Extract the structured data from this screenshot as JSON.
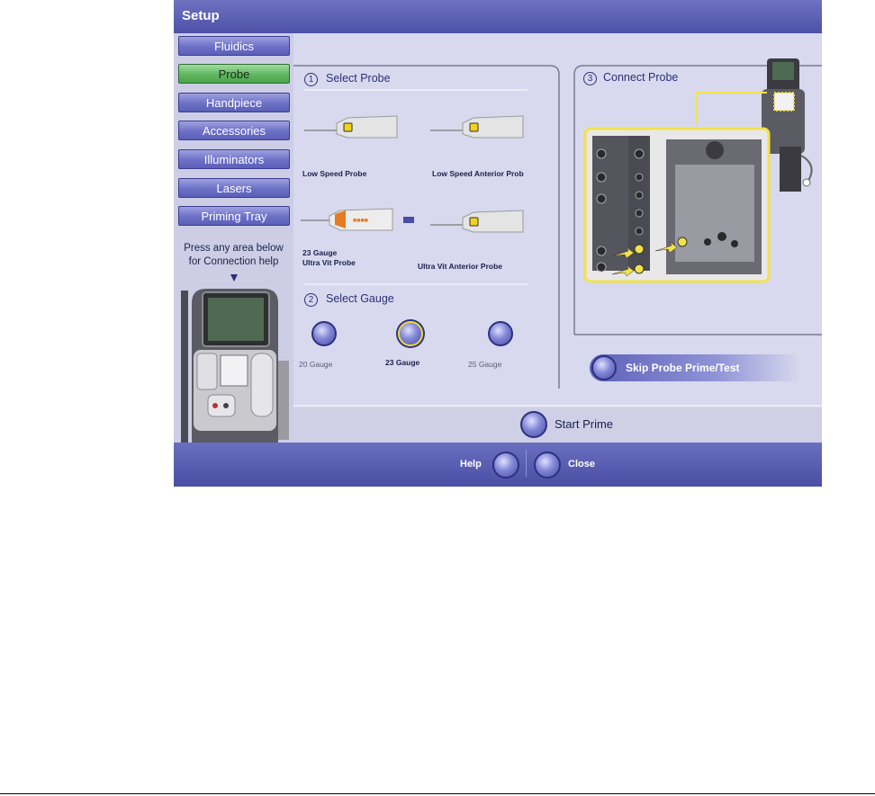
{
  "window": {
    "title": "Setup"
  },
  "nav": {
    "items": [
      {
        "label": "Fluidics"
      },
      {
        "label": "Probe"
      },
      {
        "label": "Handpiece"
      },
      {
        "label": "Accessories"
      },
      {
        "label": "Illuminators"
      },
      {
        "label": "Lasers"
      },
      {
        "label": "Priming Tray"
      }
    ],
    "help_text_line1": "Press any area below",
    "help_text_line2": "for Connection help"
  },
  "select_probe": {
    "number": "1",
    "title": "Select Probe",
    "probes": [
      {
        "label_line1": "Low Speed Probe",
        "label_line2": ""
      },
      {
        "label_line1": "Low  Speed  Anterior Prob",
        "label_line2": ""
      },
      {
        "label_line1": "23 Gauge",
        "label_line2": "Ultra Vit Probe"
      },
      {
        "label_line1": "Ultra Vit Anterior Probe",
        "label_line2": ""
      }
    ]
  },
  "select_gauge": {
    "number": "2",
    "title": "Select Gauge",
    "gauges": [
      {
        "label": "20 Gauge"
      },
      {
        "label": "23 Gauge"
      },
      {
        "label": "25 Gauge"
      }
    ]
  },
  "connect_probe": {
    "number": "3",
    "title": "Connect Probe"
  },
  "actions": {
    "skip_label": "Skip Probe Prime/Test",
    "start_prime_label": "Start Prime",
    "help_label": "Help",
    "close_label": "Close"
  },
  "colors": {
    "accent": "#5b5fb8",
    "active_nav": "#5fb65f",
    "highlight": "#f2e24a"
  }
}
